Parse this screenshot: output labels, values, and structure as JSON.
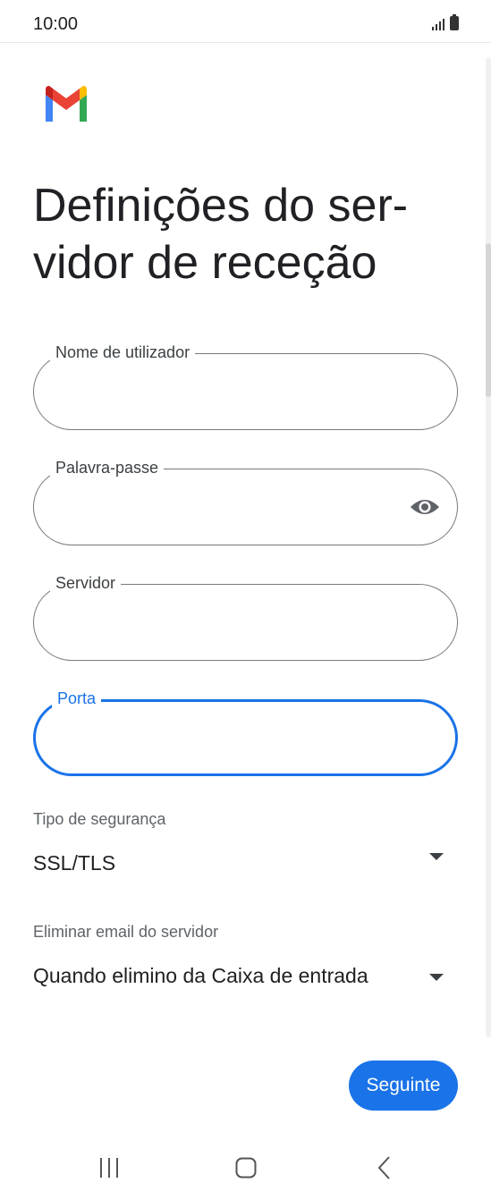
{
  "status_bar": {
    "time": "10:00"
  },
  "logo": {
    "icon": "gmail-logo-icon"
  },
  "title": "Definições do ser-vidor de receção",
  "fields": {
    "username": {
      "label": "Nome de utilizador",
      "value": ""
    },
    "password": {
      "label": "Palavra-passe",
      "value": ""
    },
    "server": {
      "label": "Servidor",
      "value": ""
    },
    "port": {
      "label": "Porta",
      "value": "",
      "focused": true
    }
  },
  "security": {
    "label": "Tipo de segurança",
    "value": "SSL/TLS"
  },
  "delete_email": {
    "label": "Eliminar email do servidor",
    "value": "Quando elimino da Caixa de entrada"
  },
  "next_button": {
    "label": "Seguinte"
  },
  "colors": {
    "accent": "#1a73e8",
    "outline": "#7a7a7a",
    "text": "#202124"
  }
}
